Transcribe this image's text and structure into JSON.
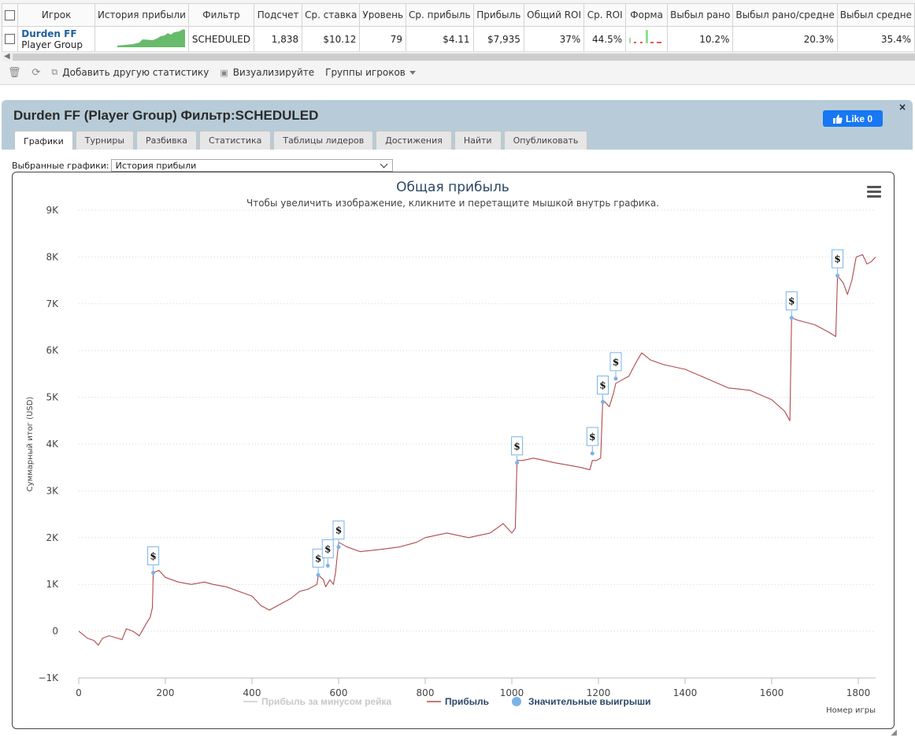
{
  "grid": {
    "columns": [
      "Игрок",
      "История прибыли",
      "Фильтр",
      "Подсчет",
      "Ср. ставка",
      "Уровень",
      "Ср. прибыль",
      "Прибыль",
      "Общий ROI",
      "Ср. ROI",
      "Форма",
      "Выбыл рано",
      "Выбыл рано/средне",
      "Выбыл средне"
    ],
    "row": {
      "player": "Durden FF",
      "group": "Player Group",
      "filter": "SCHEDULED",
      "count": "1,838",
      "avg_stake": "$10.12",
      "level": "79",
      "avg_profit": "$4.11",
      "profit": "$7,935",
      "total_roi": "37%",
      "avg_roi": "44.5%",
      "early": "10.2%",
      "early_mid": "20.3%",
      "mid": "35.4%"
    }
  },
  "toolbar": {
    "add_stat": "Добавить другую статистику",
    "visualize": "Визуализируйте",
    "groups": "Группы игроков"
  },
  "panel": {
    "title": "Durden FF (Player Group) Фильтр:SCHEDULED",
    "like": "Like 0",
    "close": "×",
    "tabs": [
      "Графики",
      "Турниры",
      "Разбивка",
      "Статистика",
      "Таблицы лидеров",
      "Достижения",
      "Найти",
      "Опубликовать"
    ],
    "active_tab": 0,
    "select_label": "Выбранные графики:",
    "select_value": "История прибыли"
  },
  "colors": {
    "accent": "#1f5f9e",
    "line": "#b04a4a",
    "marker": "#7ab3e8",
    "panel": "#b7ccd8",
    "fb": "#1877f2"
  },
  "chart_data": {
    "type": "line",
    "title": "Общая прибыль",
    "subtitle": "Чтобы увеличить изображение, кликните и перетащите мышкой внутрь графика.",
    "xlabel": "Номер игры",
    "ylabel": "Суммарный итог (USD)",
    "xlim": [
      0,
      1840
    ],
    "ylim": [
      -1000,
      9000
    ],
    "x_ticks": [
      0,
      200,
      400,
      600,
      800,
      1000,
      1200,
      1400,
      1600,
      1800
    ],
    "y_ticks": [
      -1000,
      0,
      1000,
      2000,
      3000,
      4000,
      5000,
      6000,
      7000,
      8000,
      9000
    ],
    "y_tick_labels": [
      "−1K",
      "0",
      "1K",
      "2K",
      "3K",
      "4K",
      "5K",
      "6K",
      "7K",
      "8K",
      "9K"
    ],
    "grid": "horizontal dotted",
    "legend": [
      {
        "name": "Прибыль за минусом рейка",
        "hidden": true
      },
      {
        "name": "Прибыль"
      },
      {
        "name": "Значительные выигрыши"
      }
    ],
    "series": [
      {
        "name": "Прибыль",
        "points": [
          [
            0,
            0
          ],
          [
            20,
            -150
          ],
          [
            35,
            -200
          ],
          [
            45,
            -300
          ],
          [
            55,
            -150
          ],
          [
            70,
            -100
          ],
          [
            90,
            -150
          ],
          [
            100,
            -180
          ],
          [
            110,
            50
          ],
          [
            125,
            0
          ],
          [
            140,
            -100
          ],
          [
            155,
            150
          ],
          [
            165,
            300
          ],
          [
            170,
            500
          ],
          [
            172,
            1250
          ],
          [
            185,
            1300
          ],
          [
            200,
            1150
          ],
          [
            230,
            1050
          ],
          [
            260,
            1000
          ],
          [
            290,
            1050
          ],
          [
            310,
            1000
          ],
          [
            340,
            950
          ],
          [
            370,
            850
          ],
          [
            400,
            750
          ],
          [
            420,
            550
          ],
          [
            440,
            450
          ],
          [
            460,
            550
          ],
          [
            490,
            700
          ],
          [
            510,
            850
          ],
          [
            530,
            900
          ],
          [
            550,
            1000
          ],
          [
            553,
            1200
          ],
          [
            565,
            1100
          ],
          [
            570,
            950
          ],
          [
            580,
            1100
          ],
          [
            588,
            1000
          ],
          [
            593,
            1250
          ],
          [
            600,
            1900
          ],
          [
            620,
            1800
          ],
          [
            650,
            1700
          ],
          [
            700,
            1750
          ],
          [
            740,
            1800
          ],
          [
            780,
            1900
          ],
          [
            800,
            2000
          ],
          [
            850,
            2100
          ],
          [
            900,
            2000
          ],
          [
            950,
            2100
          ],
          [
            980,
            2300
          ],
          [
            1000,
            2100
          ],
          [
            1008,
            2200
          ],
          [
            1012,
            3650
          ],
          [
            1025,
            3650
          ],
          [
            1050,
            3700
          ],
          [
            1100,
            3600
          ],
          [
            1130,
            3550
          ],
          [
            1160,
            3500
          ],
          [
            1180,
            3450
          ],
          [
            1186,
            3650
          ],
          [
            1195,
            3650
          ],
          [
            1205,
            3700
          ],
          [
            1210,
            4950
          ],
          [
            1225,
            4800
          ],
          [
            1235,
            5100
          ],
          [
            1240,
            5300
          ],
          [
            1250,
            5350
          ],
          [
            1270,
            5450
          ],
          [
            1290,
            5800
          ],
          [
            1300,
            5950
          ],
          [
            1320,
            5800
          ],
          [
            1350,
            5700
          ],
          [
            1400,
            5600
          ],
          [
            1450,
            5400
          ],
          [
            1500,
            5200
          ],
          [
            1550,
            5150
          ],
          [
            1600,
            4950
          ],
          [
            1630,
            4700
          ],
          [
            1642,
            4500
          ],
          [
            1646,
            6700
          ],
          [
            1660,
            6650
          ],
          [
            1700,
            6550
          ],
          [
            1730,
            6400
          ],
          [
            1748,
            6300
          ],
          [
            1752,
            7600
          ],
          [
            1765,
            7450
          ],
          [
            1775,
            7200
          ],
          [
            1785,
            7500
          ],
          [
            1795,
            8000
          ],
          [
            1810,
            8050
          ],
          [
            1820,
            7850
          ],
          [
            1830,
            7900
          ],
          [
            1840,
            8000
          ]
        ]
      },
      {
        "name": "Значительные выигрыши",
        "symbol": "$",
        "points": [
          [
            172,
            1250
          ],
          [
            553,
            1200
          ],
          [
            575,
            1400
          ],
          [
            600,
            1800
          ],
          [
            1012,
            3600
          ],
          [
            1186,
            3800
          ],
          [
            1210,
            4900
          ],
          [
            1240,
            5400
          ],
          [
            1646,
            6700
          ],
          [
            1752,
            7600
          ]
        ]
      }
    ]
  }
}
